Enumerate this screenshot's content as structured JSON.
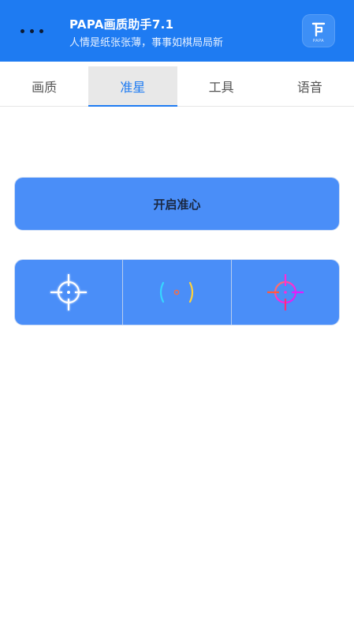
{
  "header": {
    "title": "PAPA画质助手7.1",
    "subtitle": "人情是纸张张薄，事事如棋局局新",
    "logo_text": "PAPA",
    "background_color": "#1e7bf2"
  },
  "tabs": [
    {
      "label": "画质",
      "active": false
    },
    {
      "label": "准星",
      "active": true
    },
    {
      "label": "工具",
      "active": false
    },
    {
      "label": "语音",
      "active": false
    }
  ],
  "main": {
    "toggle_button_label": "开启准心",
    "crosshair_options": [
      {
        "icon": "crosshair-white-icon"
      },
      {
        "icon": "bracket-crosshair-icon"
      },
      {
        "icon": "crosshair-magenta-icon"
      }
    ],
    "accent_color": "#4a8ef8"
  }
}
